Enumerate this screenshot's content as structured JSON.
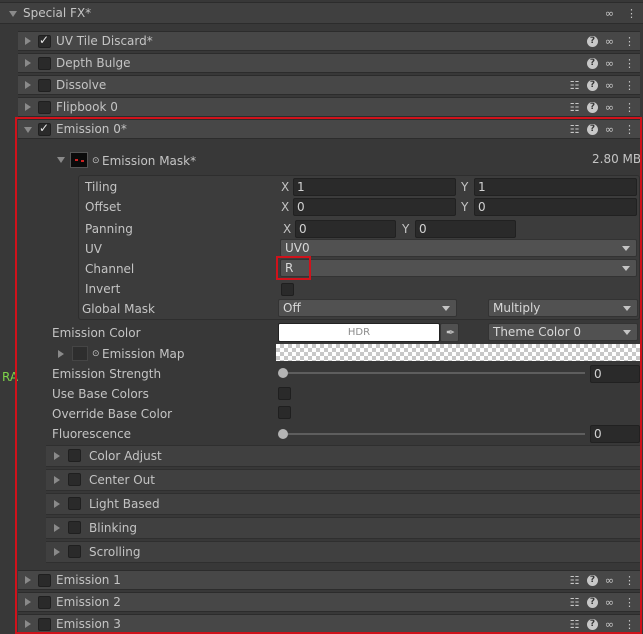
{
  "panel": {
    "title": "Special FX*"
  },
  "modules": {
    "uv_tile_discard": "UV Tile Discard*",
    "depth_bulge": "Depth Bulge",
    "dissolve": "Dissolve",
    "flipbook0": "Flipbook 0",
    "emission0": "Emission 0*",
    "emission1": "Emission 1",
    "emission2": "Emission 2",
    "emission3": "Emission 3"
  },
  "mask": {
    "title": "Emission Mask*",
    "size": "2.80 MB",
    "tiling_label": "Tiling",
    "tiling_x": "1",
    "tiling_y": "1",
    "offset_label": "Offset",
    "offset_x": "0",
    "offset_y": "0",
    "panning_label": "Panning",
    "panning_x": "0",
    "panning_y": "0",
    "uv_label": "UV",
    "uv_value": "UV0",
    "channel_label": "Channel",
    "channel_value": "R",
    "invert_label": "Invert",
    "global_mask_label": "Global Mask",
    "global_mask_value": "Off",
    "global_mask_mode": "Multiply",
    "x": "X",
    "y": "Y"
  },
  "emission": {
    "color_label": "Emission Color",
    "hdr": "HDR",
    "theme_color": "Theme Color 0",
    "map_label": "Emission Map",
    "strength_label": "Emission Strength",
    "strength_value": "0",
    "use_base_colors": "Use Base Colors",
    "override_base_color": "Override Base Color",
    "fluorescence_label": "Fluorescence",
    "fluorescence_value": "0"
  },
  "subsections": [
    "Color Adjust",
    "Center Out",
    "Light Based",
    "Blinking",
    "Scrolling"
  ],
  "side_label": "RA",
  "colors": {
    "highlight": "#d0121b",
    "accent_green": "#7dd34a"
  },
  "icons": [
    "settings-sliders-icon",
    "help-icon",
    "link-icon",
    "menu-icon",
    "eyedropper-icon",
    "picker-circle-icon"
  ]
}
